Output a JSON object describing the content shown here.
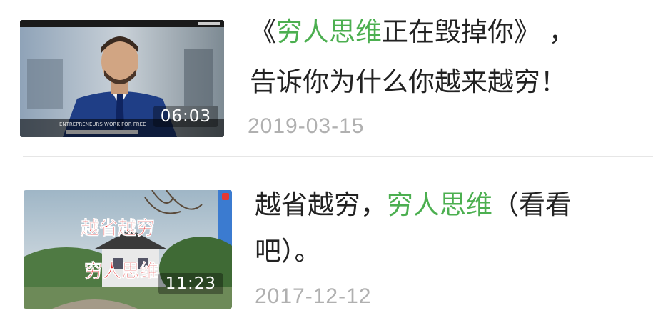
{
  "items": [
    {
      "title_line1": {
        "open": "《",
        "highlight": "穷人思维",
        "rest": "正在毁掉你》 ，"
      },
      "title_line2": "告诉你为什么你越来越穷！",
      "duration": "06:03",
      "date": "2019-03-15",
      "thumb_caption": "ENTREPRENEURS WORK FOR FREE",
      "thumb_icon": "play-video-thumbnail"
    },
    {
      "title_line1": {
        "open": "越省越穷，",
        "highlight": "穷人思维",
        "rest": "（看看"
      },
      "title_line2": "吧）。",
      "duration": "11:23",
      "date": "2017-12-12",
      "thumb_text_top": "越省越穷",
      "thumb_text_bottom": "穷人思维",
      "thumb_icon": "play-video-thumbnail"
    }
  ],
  "colors": {
    "highlight": "#4caf50",
    "date": "#b0b0b0",
    "title": "#222222",
    "divider": "#e6e6e6"
  }
}
